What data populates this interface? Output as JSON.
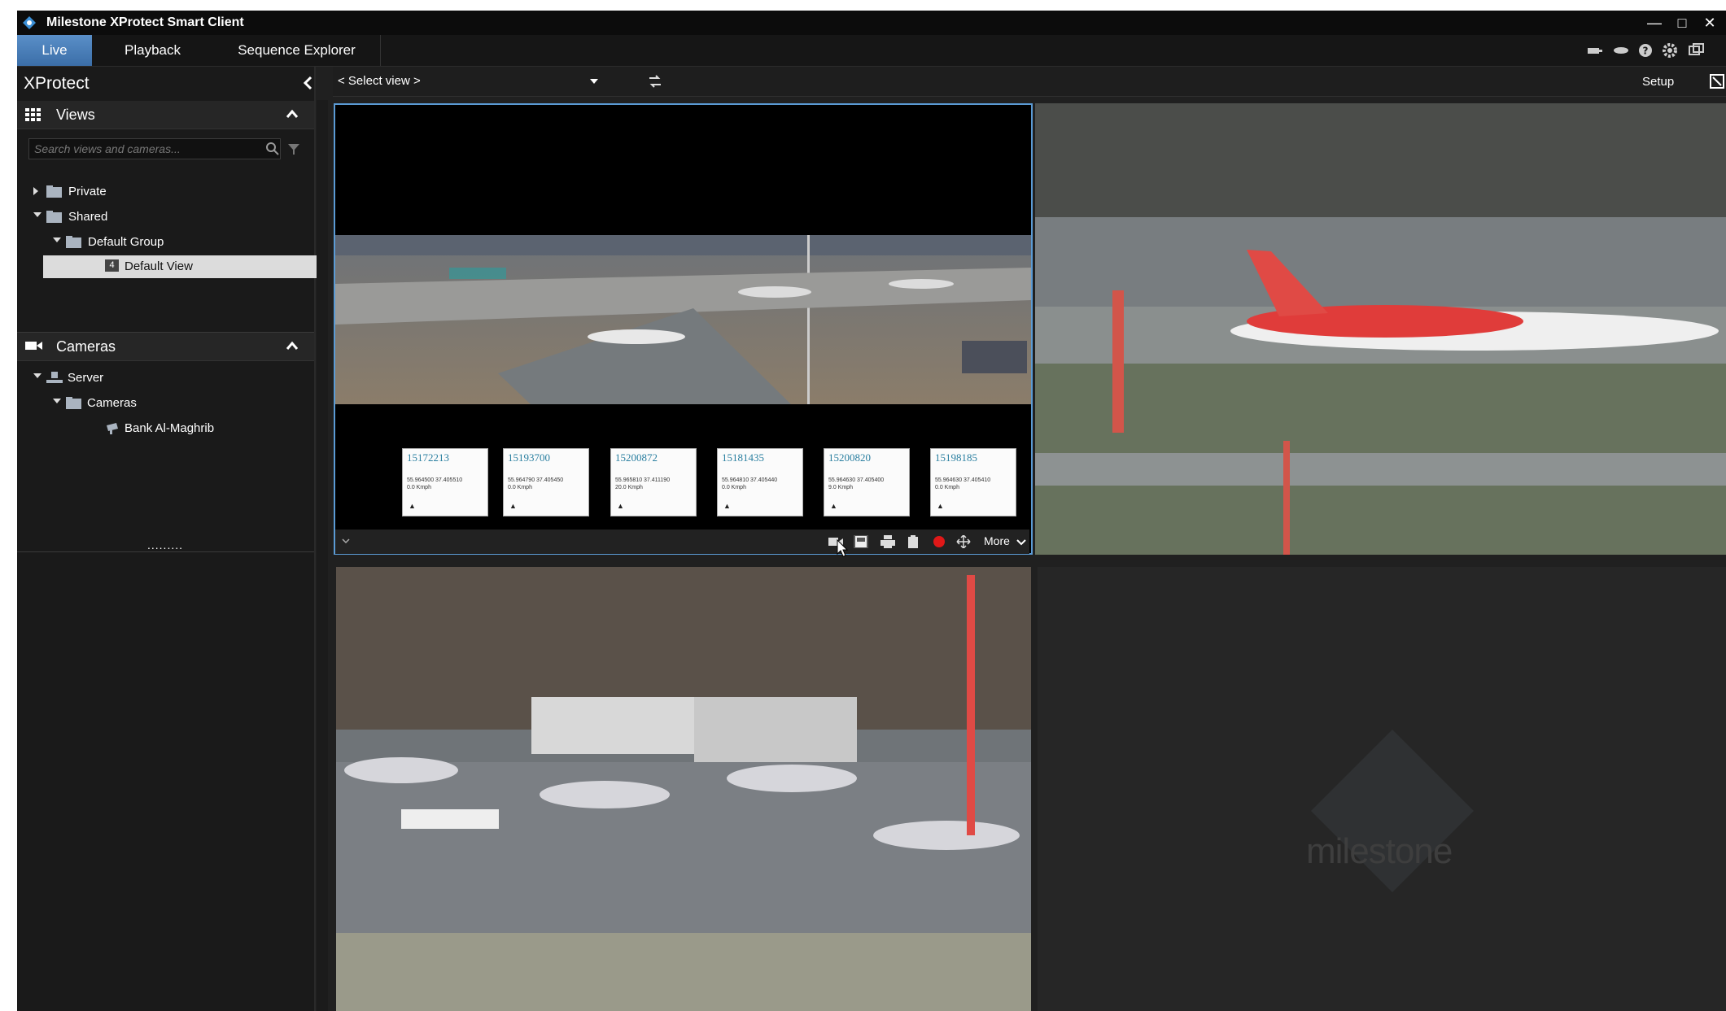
{
  "window": {
    "title": "Milestone XProtect Smart Client",
    "controls": [
      "minimize-icon",
      "maximize-icon",
      "close-icon"
    ]
  },
  "tabs": [
    {
      "label": "Live",
      "active": true
    },
    {
      "label": "Playback",
      "active": false
    },
    {
      "label": "Sequence Explorer",
      "active": false
    }
  ],
  "sidebar": {
    "title": "XProtect",
    "views": {
      "header": "Views",
      "search_placeholder": "Search views and cameras...",
      "tree": {
        "private": "Private",
        "shared": "Shared",
        "group": "Default Group",
        "view_number": "4",
        "view": "Default View"
      }
    },
    "cameras": {
      "header": "Cameras",
      "tree": {
        "server": "Server",
        "folder": "Cameras",
        "camera": "Bank Al-Maghrib"
      }
    },
    "resize_handle": "........."
  },
  "viewbar": {
    "select_view": "< Select view >",
    "setup": "Setup"
  },
  "camera_toolbar": {
    "more": "More"
  },
  "plates": [
    {
      "number": "15172213",
      "coords": "55.964500 37.405510\n0.0 Kmph"
    },
    {
      "number": "15193700",
      "coords": "55.964790 37.405450\n0.0 Kmph"
    },
    {
      "number": "15200872",
      "coords": "55.965810 37.411190\n20.0 Kmph"
    },
    {
      "number": "15181435",
      "coords": "55.964810 37.405440\n0.0 Kmph"
    },
    {
      "number": "15200820",
      "coords": "55.964630 37.405400\n9.0 Kmph"
    },
    {
      "number": "15198185",
      "coords": "55.964630 37.405410\n0.0 Kmph"
    }
  ],
  "watermark": "milestone",
  "colors": {
    "active_tab": "#4a7fbf",
    "record": "#e01818",
    "selection_border": "#5b9bd5"
  }
}
